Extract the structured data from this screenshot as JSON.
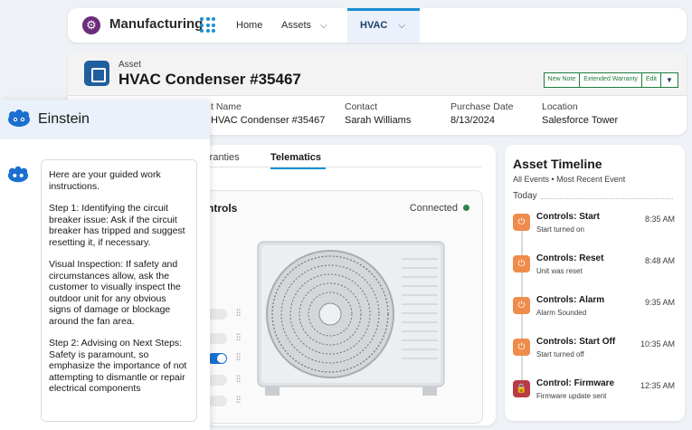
{
  "nav": {
    "app_name": "Manufacturing",
    "items": [
      {
        "label": "Home"
      },
      {
        "label": "Assets"
      },
      {
        "label": "HVAC"
      }
    ]
  },
  "record": {
    "type_label": "Asset",
    "title": "HVAC Condenser #35467",
    "actions": [
      "New Note",
      "Extended Warranty",
      "Edit"
    ],
    "fields": [
      {
        "label": "t Name",
        "value": "HVAC Condenser #35467"
      },
      {
        "label": "Contact",
        "value": "Sarah Williams"
      },
      {
        "label": "Purchase Date",
        "value": "8/13/2024"
      },
      {
        "label": "Location",
        "value": "Salesforce Tower"
      }
    ]
  },
  "tabs": [
    {
      "label": "rranties"
    },
    {
      "label": "Telematics",
      "active": true
    }
  ],
  "controls": {
    "title": "ntrols",
    "status": "Connected",
    "status_color": "#2e844a",
    "toggles": [
      false,
      false,
      true,
      false,
      false
    ]
  },
  "timeline": {
    "title": "Asset Timeline",
    "subtitle": "All Events • Most Recent Event",
    "group": "Today",
    "events": [
      {
        "title": "Controls: Start",
        "desc": "Start turned on",
        "time": "8:35 AM",
        "icon": "power-icon"
      },
      {
        "title": "Controls: Reset",
        "desc": "Unit was reset",
        "time": "8:48 AM",
        "icon": "power-icon"
      },
      {
        "title": "Controls: Alarm",
        "desc": "Alarm Sounded",
        "time": "9:35 AM",
        "icon": "power-icon"
      },
      {
        "title": "Controls: Start Off",
        "desc": "Start turned off",
        "time": "10:35 AM",
        "icon": "power-icon"
      },
      {
        "title": "Control: Firmware",
        "desc": "Firmware update sent",
        "time": "12:35 AM",
        "icon": "lock-icon"
      }
    ]
  },
  "einstein": {
    "title": "Einstein",
    "paragraphs": [
      "Here are your guided work instructions.",
      "Step 1: Identifying the circuit breaker issue: Ask if the circuit breaker has tripped and suggest resetting it, if necessary.",
      "Visual Inspection: If safety and circumstances allow, ask the customer to visually inspect the outdoor unit for any obvious signs of damage or blockage around the fan area.",
      "Step 2: Advising on Next Steps: Safety is paramount, so emphasize the importance of not attempting to dismantle or repair electrical components"
    ]
  }
}
